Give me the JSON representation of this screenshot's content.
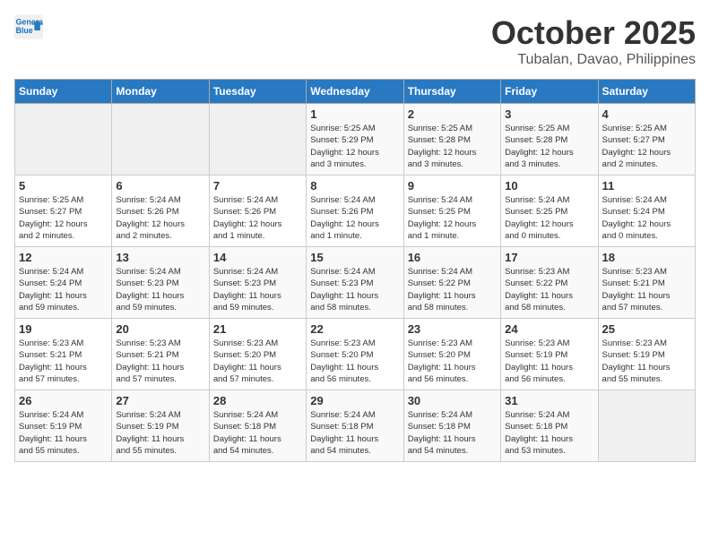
{
  "header": {
    "logo_line1": "General",
    "logo_line2": "Blue",
    "month": "October 2025",
    "location": "Tubalan, Davao, Philippines"
  },
  "weekdays": [
    "Sunday",
    "Monday",
    "Tuesday",
    "Wednesday",
    "Thursday",
    "Friday",
    "Saturday"
  ],
  "weeks": [
    [
      {
        "day": "",
        "info": ""
      },
      {
        "day": "",
        "info": ""
      },
      {
        "day": "",
        "info": ""
      },
      {
        "day": "1",
        "info": "Sunrise: 5:25 AM\nSunset: 5:29 PM\nDaylight: 12 hours\nand 3 minutes."
      },
      {
        "day": "2",
        "info": "Sunrise: 5:25 AM\nSunset: 5:28 PM\nDaylight: 12 hours\nand 3 minutes."
      },
      {
        "day": "3",
        "info": "Sunrise: 5:25 AM\nSunset: 5:28 PM\nDaylight: 12 hours\nand 3 minutes."
      },
      {
        "day": "4",
        "info": "Sunrise: 5:25 AM\nSunset: 5:27 PM\nDaylight: 12 hours\nand 2 minutes."
      }
    ],
    [
      {
        "day": "5",
        "info": "Sunrise: 5:25 AM\nSunset: 5:27 PM\nDaylight: 12 hours\nand 2 minutes."
      },
      {
        "day": "6",
        "info": "Sunrise: 5:24 AM\nSunset: 5:26 PM\nDaylight: 12 hours\nand 2 minutes."
      },
      {
        "day": "7",
        "info": "Sunrise: 5:24 AM\nSunset: 5:26 PM\nDaylight: 12 hours\nand 1 minute."
      },
      {
        "day": "8",
        "info": "Sunrise: 5:24 AM\nSunset: 5:26 PM\nDaylight: 12 hours\nand 1 minute."
      },
      {
        "day": "9",
        "info": "Sunrise: 5:24 AM\nSunset: 5:25 PM\nDaylight: 12 hours\nand 1 minute."
      },
      {
        "day": "10",
        "info": "Sunrise: 5:24 AM\nSunset: 5:25 PM\nDaylight: 12 hours\nand 0 minutes."
      },
      {
        "day": "11",
        "info": "Sunrise: 5:24 AM\nSunset: 5:24 PM\nDaylight: 12 hours\nand 0 minutes."
      }
    ],
    [
      {
        "day": "12",
        "info": "Sunrise: 5:24 AM\nSunset: 5:24 PM\nDaylight: 11 hours\nand 59 minutes."
      },
      {
        "day": "13",
        "info": "Sunrise: 5:24 AM\nSunset: 5:23 PM\nDaylight: 11 hours\nand 59 minutes."
      },
      {
        "day": "14",
        "info": "Sunrise: 5:24 AM\nSunset: 5:23 PM\nDaylight: 11 hours\nand 59 minutes."
      },
      {
        "day": "15",
        "info": "Sunrise: 5:24 AM\nSunset: 5:23 PM\nDaylight: 11 hours\nand 58 minutes."
      },
      {
        "day": "16",
        "info": "Sunrise: 5:24 AM\nSunset: 5:22 PM\nDaylight: 11 hours\nand 58 minutes."
      },
      {
        "day": "17",
        "info": "Sunrise: 5:23 AM\nSunset: 5:22 PM\nDaylight: 11 hours\nand 58 minutes."
      },
      {
        "day": "18",
        "info": "Sunrise: 5:23 AM\nSunset: 5:21 PM\nDaylight: 11 hours\nand 57 minutes."
      }
    ],
    [
      {
        "day": "19",
        "info": "Sunrise: 5:23 AM\nSunset: 5:21 PM\nDaylight: 11 hours\nand 57 minutes."
      },
      {
        "day": "20",
        "info": "Sunrise: 5:23 AM\nSunset: 5:21 PM\nDaylight: 11 hours\nand 57 minutes."
      },
      {
        "day": "21",
        "info": "Sunrise: 5:23 AM\nSunset: 5:20 PM\nDaylight: 11 hours\nand 57 minutes."
      },
      {
        "day": "22",
        "info": "Sunrise: 5:23 AM\nSunset: 5:20 PM\nDaylight: 11 hours\nand 56 minutes."
      },
      {
        "day": "23",
        "info": "Sunrise: 5:23 AM\nSunset: 5:20 PM\nDaylight: 11 hours\nand 56 minutes."
      },
      {
        "day": "24",
        "info": "Sunrise: 5:23 AM\nSunset: 5:19 PM\nDaylight: 11 hours\nand 56 minutes."
      },
      {
        "day": "25",
        "info": "Sunrise: 5:23 AM\nSunset: 5:19 PM\nDaylight: 11 hours\nand 55 minutes."
      }
    ],
    [
      {
        "day": "26",
        "info": "Sunrise: 5:24 AM\nSunset: 5:19 PM\nDaylight: 11 hours\nand 55 minutes."
      },
      {
        "day": "27",
        "info": "Sunrise: 5:24 AM\nSunset: 5:19 PM\nDaylight: 11 hours\nand 55 minutes."
      },
      {
        "day": "28",
        "info": "Sunrise: 5:24 AM\nSunset: 5:18 PM\nDaylight: 11 hours\nand 54 minutes."
      },
      {
        "day": "29",
        "info": "Sunrise: 5:24 AM\nSunset: 5:18 PM\nDaylight: 11 hours\nand 54 minutes."
      },
      {
        "day": "30",
        "info": "Sunrise: 5:24 AM\nSunset: 5:18 PM\nDaylight: 11 hours\nand 54 minutes."
      },
      {
        "day": "31",
        "info": "Sunrise: 5:24 AM\nSunset: 5:18 PM\nDaylight: 11 hours\nand 53 minutes."
      },
      {
        "day": "",
        "info": ""
      }
    ]
  ]
}
